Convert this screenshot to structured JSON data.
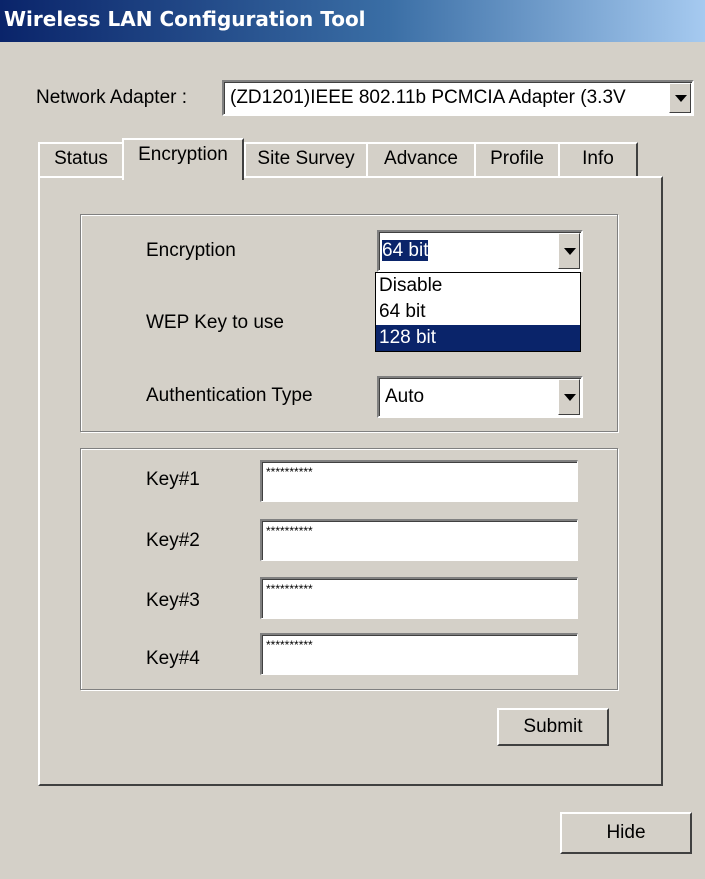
{
  "window": {
    "title": "Wireless LAN Configuration Tool"
  },
  "adapter": {
    "label": "Network Adapter :",
    "value": "(ZD1201)IEEE 802.11b PCMCIA Adapter (3.3V"
  },
  "tabs": [
    {
      "label": "Status"
    },
    {
      "label": "Encryption"
    },
    {
      "label": "Site Survey"
    },
    {
      "label": "Advance"
    },
    {
      "label": "Profile"
    },
    {
      "label": "Info"
    }
  ],
  "active_tab": "Encryption",
  "encryption": {
    "label": "Encryption",
    "value": "64 bit",
    "options": [
      "Disable",
      "64 bit",
      "128 bit"
    ],
    "highlighted_option": "128 bit"
  },
  "wep_key": {
    "label": "WEP Key to use"
  },
  "auth": {
    "label": "Authentication Type",
    "value": "Auto"
  },
  "keys": [
    {
      "label": "Key#1",
      "value": "**********"
    },
    {
      "label": "Key#2",
      "value": "**********"
    },
    {
      "label": "Key#3",
      "value": "**********"
    },
    {
      "label": "Key#4",
      "value": "**********"
    }
  ],
  "buttons": {
    "submit": "Submit",
    "hide": "Hide"
  },
  "colors": {
    "face": "#d4d0c8",
    "title_start": "#0a246a",
    "title_end": "#a6caf0",
    "selection": "#0a246a"
  }
}
